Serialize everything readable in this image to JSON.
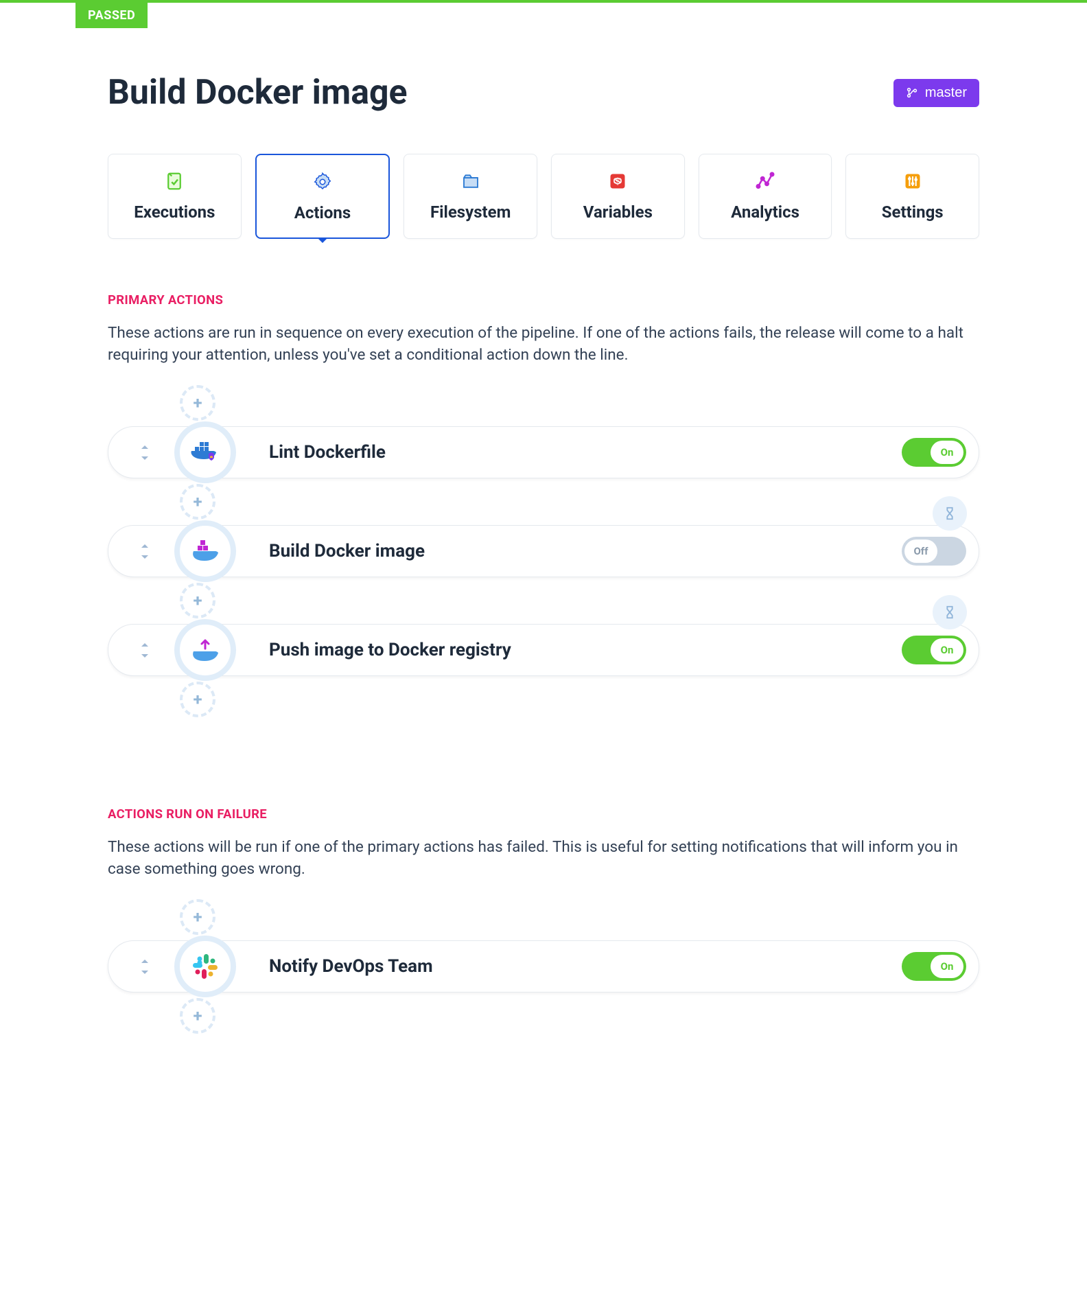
{
  "status_badge": "PASSED",
  "page_title": "Build Docker image",
  "branch_label": "master",
  "tabs": [
    {
      "label": "Executions"
    },
    {
      "label": "Actions"
    },
    {
      "label": "Filesystem"
    },
    {
      "label": "Variables"
    },
    {
      "label": "Analytics"
    },
    {
      "label": "Settings"
    }
  ],
  "primary": {
    "title": "PRIMARY ACTIONS",
    "desc": "These actions are run in sequence on every execution of the pipeline. If one of the actions fails, the release will come to a halt requiring your attention, unless you've set a conditional action down the line.",
    "actions": [
      {
        "name": "Lint Dockerfile",
        "toggle": "On",
        "on": true,
        "wait": false,
        "icon": "docker-lint"
      },
      {
        "name": "Build Docker image",
        "toggle": "Off",
        "on": false,
        "wait": true,
        "icon": "docker-build"
      },
      {
        "name": "Push image to Docker registry",
        "toggle": "On",
        "on": true,
        "wait": true,
        "icon": "docker-push"
      }
    ]
  },
  "failure": {
    "title": "ACTIONS RUN ON FAILURE",
    "desc": "These actions will be run if one of the primary actions has failed. This is useful for setting notifications that will inform you in case something goes wrong.",
    "actions": [
      {
        "name": "Notify DevOps Team",
        "toggle": "On",
        "on": true,
        "wait": false,
        "icon": "slack"
      }
    ]
  },
  "colors": {
    "green": "#5bcc32",
    "purple": "#7c3aed",
    "blue": "#1a56db",
    "pink": "#e91e63"
  }
}
